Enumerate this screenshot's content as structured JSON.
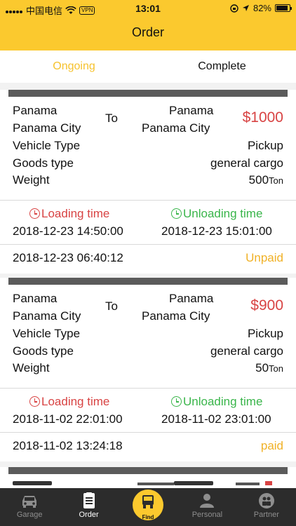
{
  "status_bar": {
    "carrier": "中国电信",
    "vpn": "VPN",
    "time": "13:01",
    "battery": "82%"
  },
  "header": {
    "title": "Order"
  },
  "tabs": [
    {
      "label": "Ongoing"
    },
    {
      "label": "Complete"
    }
  ],
  "orders": [
    {
      "from_country": "Panama",
      "from_city": "Panama City",
      "to_label": "To",
      "to_country": "Panama",
      "to_city": "Panama City",
      "price": "$1000",
      "vehicle_label": "Vehicle Type",
      "vehicle_value": "Pickup",
      "goods_label": "Goods type",
      "goods_value": "general cargo",
      "weight_label": "Weight",
      "weight_value": "500",
      "weight_unit": "Ton",
      "loading_label": "Loading time",
      "unloading_label": "Unloading time",
      "loading_time": "2018-12-23 14:50:00",
      "unloading_time": "2018-12-23 15:01:00",
      "created": "2018-12-23 06:40:12",
      "payment": "Unpaid"
    },
    {
      "from_country": "Panama",
      "from_city": "Panama City",
      "to_label": "To",
      "to_country": "Panama",
      "to_city": "Panama City",
      "price": "$900",
      "vehicle_label": "Vehicle Type",
      "vehicle_value": "Pickup",
      "goods_label": "Goods type",
      "goods_value": "general cargo",
      "weight_label": "Weight",
      "weight_value": "50",
      "weight_unit": "Ton",
      "loading_label": "Loading time",
      "unloading_label": "Unloading time",
      "loading_time": "2018-11-02 22:01:00",
      "unloading_time": "2018-11-02 23:01:00",
      "created": "2018-11-02 13:24:18",
      "payment": "paid"
    }
  ],
  "tabbar": [
    {
      "label": "Garage",
      "icon": "car-icon"
    },
    {
      "label": "Order",
      "icon": "clipboard-icon"
    },
    {
      "label": "Find",
      "icon": "truck-icon"
    },
    {
      "label": "Personal",
      "icon": "person-icon"
    },
    {
      "label": "Partner",
      "icon": "partner-icon"
    }
  ],
  "colors": {
    "accent": "#fbc92e",
    "price": "#d84343",
    "loading": "#d84343",
    "unloading": "#39b54a",
    "payment": "#f0b126"
  }
}
